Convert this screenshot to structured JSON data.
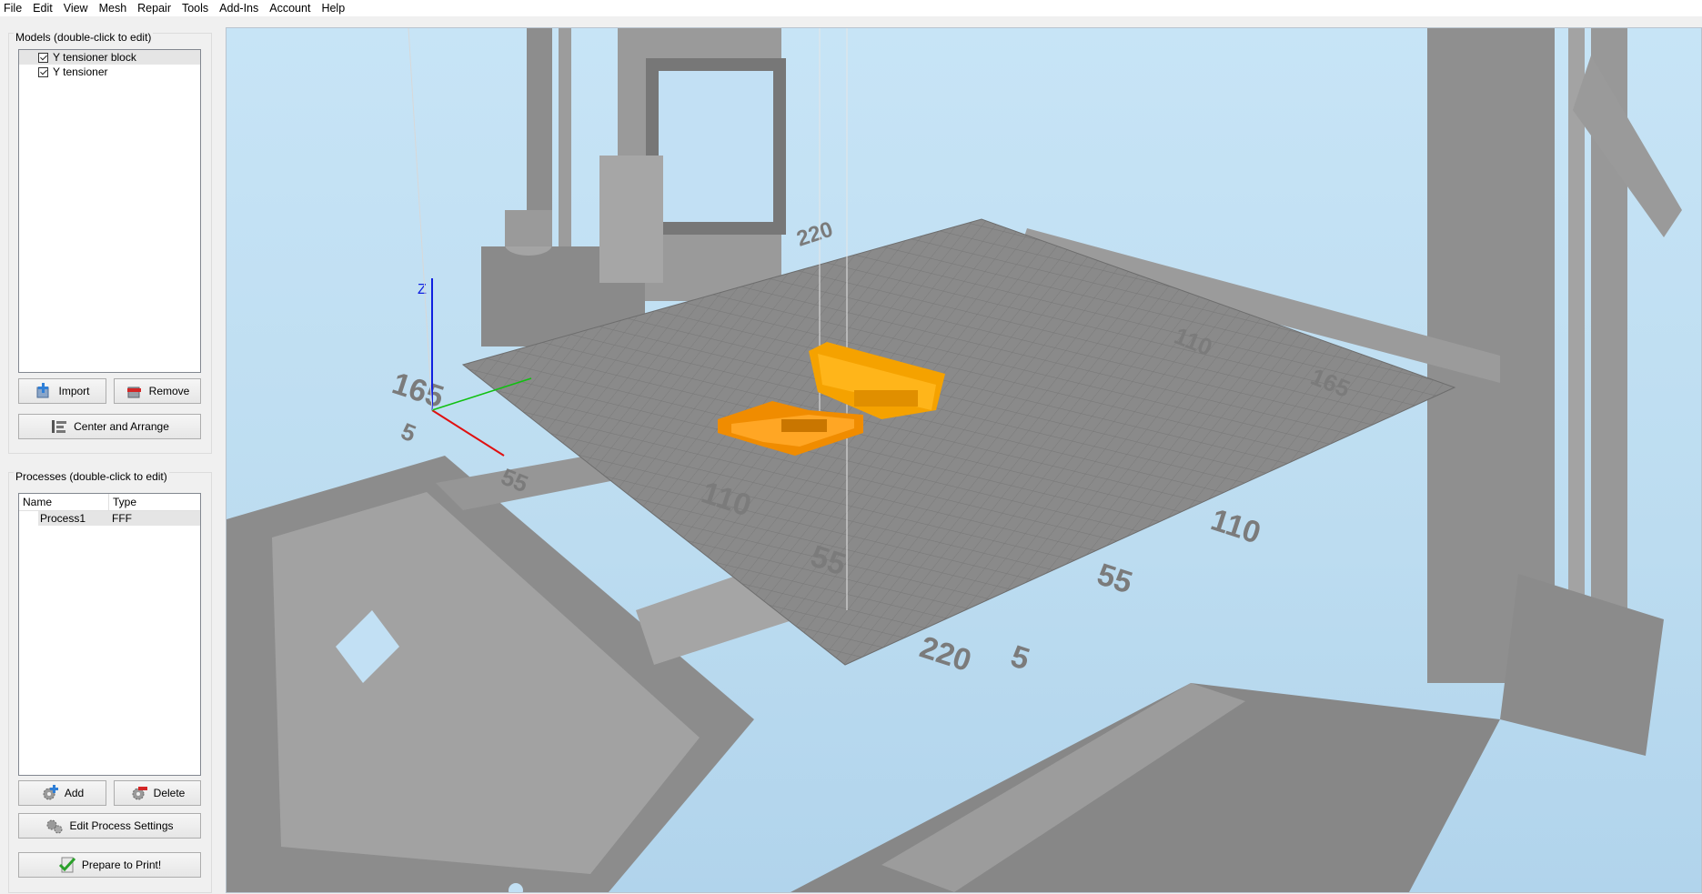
{
  "menu": [
    "File",
    "Edit",
    "View",
    "Mesh",
    "Repair",
    "Tools",
    "Add-Ins",
    "Account",
    "Help"
  ],
  "models": {
    "title": "Models (double-click to edit)",
    "items": [
      {
        "label": "Y tensioner block",
        "checked": true,
        "selected": true
      },
      {
        "label": "Y tensioner",
        "checked": true,
        "selected": false
      }
    ],
    "import_label": "Import",
    "remove_label": "Remove",
    "center_label": "Center and Arrange"
  },
  "processes": {
    "title": "Processes (double-click to edit)",
    "columns": [
      "Name",
      "Type"
    ],
    "rows": [
      {
        "name": "Process1",
        "type": "FFF"
      }
    ],
    "add_label": "Add",
    "delete_label": "Delete",
    "edit_label": "Edit Process Settings",
    "prepare_label": "Prepare to Print!"
  },
  "viewport": {
    "axis_z": "Z",
    "bed_labels": [
      "165",
      "110",
      "55",
      "220",
      "110",
      "55",
      "5",
      "220",
      "110",
      "165",
      "55",
      "5"
    ],
    "colors": {
      "part": "#f5a200",
      "frame": "#8e8e8e",
      "bed": "#8a8a8a",
      "sky": "#c2e0f4",
      "axis_x": "#e01010",
      "axis_y": "#10c010",
      "axis_z": "#1020e0"
    }
  }
}
